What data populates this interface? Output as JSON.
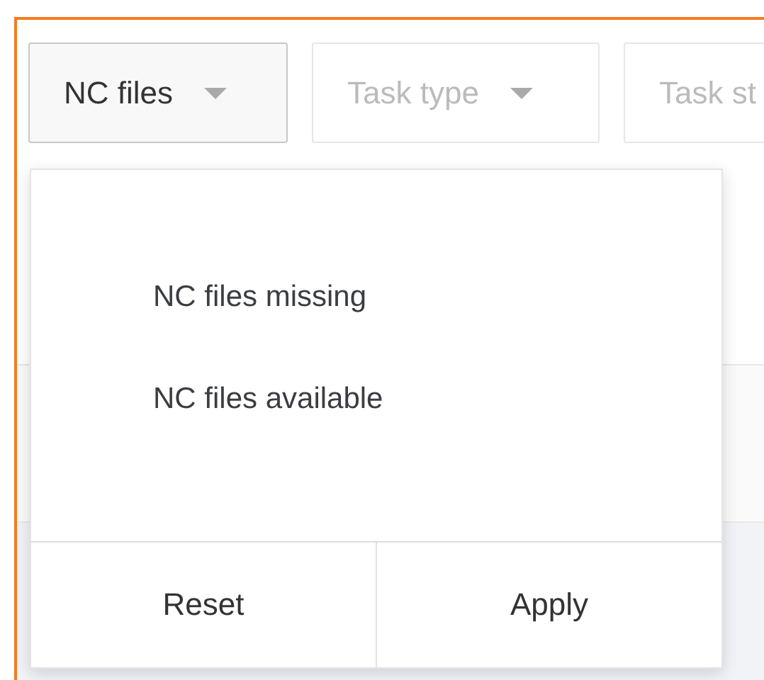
{
  "filters": [
    {
      "label": "NC files",
      "expanded": true
    },
    {
      "label": "Task type",
      "expanded": false
    },
    {
      "label": "Task st",
      "expanded": false
    }
  ],
  "dropdown": {
    "options": [
      "NC files missing",
      "NC files available"
    ],
    "buttons": [
      "Reset",
      "Apply"
    ]
  }
}
